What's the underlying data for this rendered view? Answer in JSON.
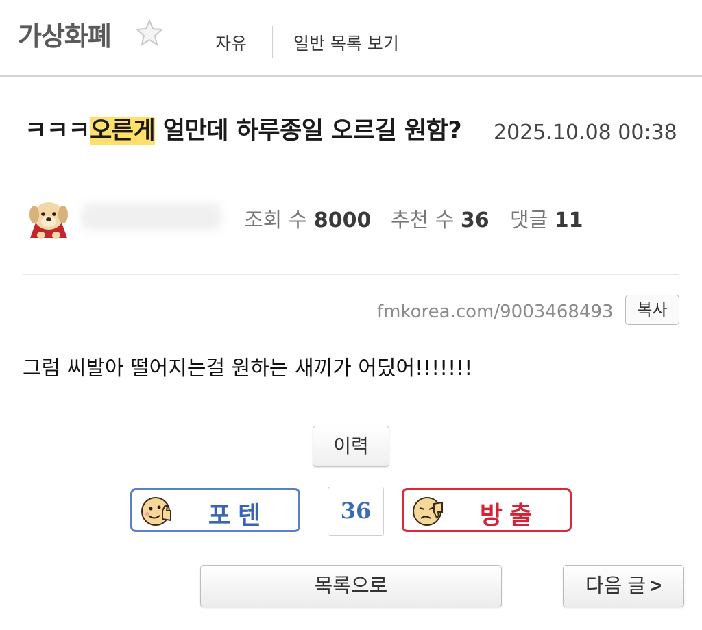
{
  "header": {
    "board_title": "가상화폐",
    "category": "자유",
    "view_mode_link": "일반 목록 보기"
  },
  "post": {
    "title_prefix": "ㅋㅋㅋ",
    "title_highlight": "오른게",
    "title_rest": " 얼만데 하루종일 오르길 원함?",
    "date": "2025.10.08 00:38",
    "views_label": "조회 수",
    "views": "8000",
    "recommend_label": "추천 수",
    "recommend": "36",
    "comments_label": "댓글",
    "comments": "11",
    "url": "fmkorea.com/9003468493",
    "copy_label": "복사",
    "body": "그럼 씨발아 떨어지는걸 원하는 새끼가 어딨어!!!!!!!"
  },
  "actions": {
    "history_label": "이력",
    "upvote_label": "포텐",
    "vote_count": "36",
    "downvote_label": "방출",
    "list_label": "목록으로",
    "next_label": "다음 글",
    "next_chevron": ">"
  },
  "colors": {
    "highlight": "#ffe06a",
    "upvote": "#3b63b3",
    "downvote": "#d22436"
  },
  "icons": {
    "favorite": "star-outline-icon",
    "avatar": "puppy-avatar",
    "upvote": "thumbs-up-face-icon",
    "downvote": "thumbs-down-face-icon"
  }
}
